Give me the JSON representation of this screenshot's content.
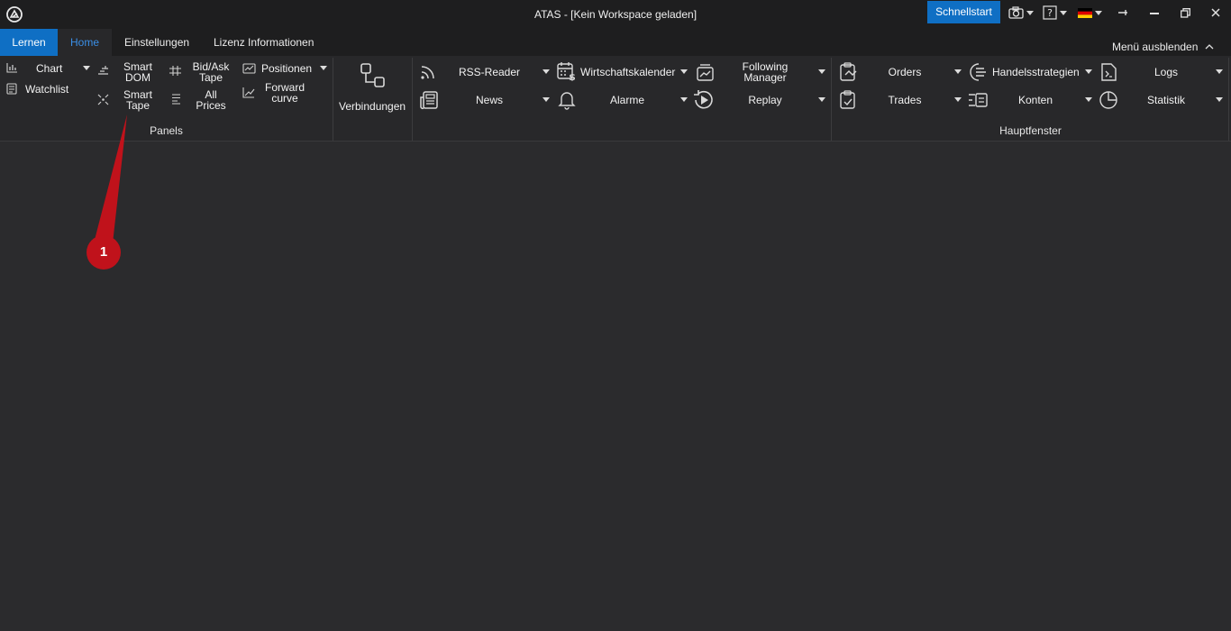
{
  "window": {
    "title": "ATAS - [Kein Workspace geladen]",
    "quickstart_label": "Schnellstart"
  },
  "tabs": {
    "learn": "Lernen",
    "home": "Home",
    "settings": "Einstellungen",
    "license": "Lizenz Informationen",
    "hide_menu": "Menü ausblenden"
  },
  "panels": {
    "group_label": "Panels",
    "chart": "Chart",
    "watchlist": "Watchlist",
    "smart_dom": [
      "Smart",
      "DOM"
    ],
    "smart_tape": [
      "Smart",
      "Tape"
    ],
    "bidask_tape": [
      "Bid/Ask",
      "Tape"
    ],
    "all_prices": [
      "All",
      "Prices"
    ],
    "positions": "Positionen",
    "forward_curve": [
      "Forward",
      "curve"
    ]
  },
  "connections": {
    "label": "Verbindungen"
  },
  "main_window": {
    "group_label": "Hauptfenster",
    "rss_reader": "RSS-Reader",
    "news": "News",
    "calendar": "Wirtschaftskalender",
    "alerts": "Alarme",
    "following_manager": [
      "Following",
      "Manager"
    ],
    "replay": "Replay",
    "orders": "Orders",
    "trades": "Trades",
    "strategies": "Handelsstrategien",
    "accounts": "Konten",
    "logs": "Logs",
    "statistics": "Statistik"
  },
  "annotation": {
    "number": "1",
    "color": "#c0121b"
  },
  "colors": {
    "accent": "#0f6fc4",
    "tab_active_text": "#3a8ee6",
    "background": "#2b2b2d"
  }
}
